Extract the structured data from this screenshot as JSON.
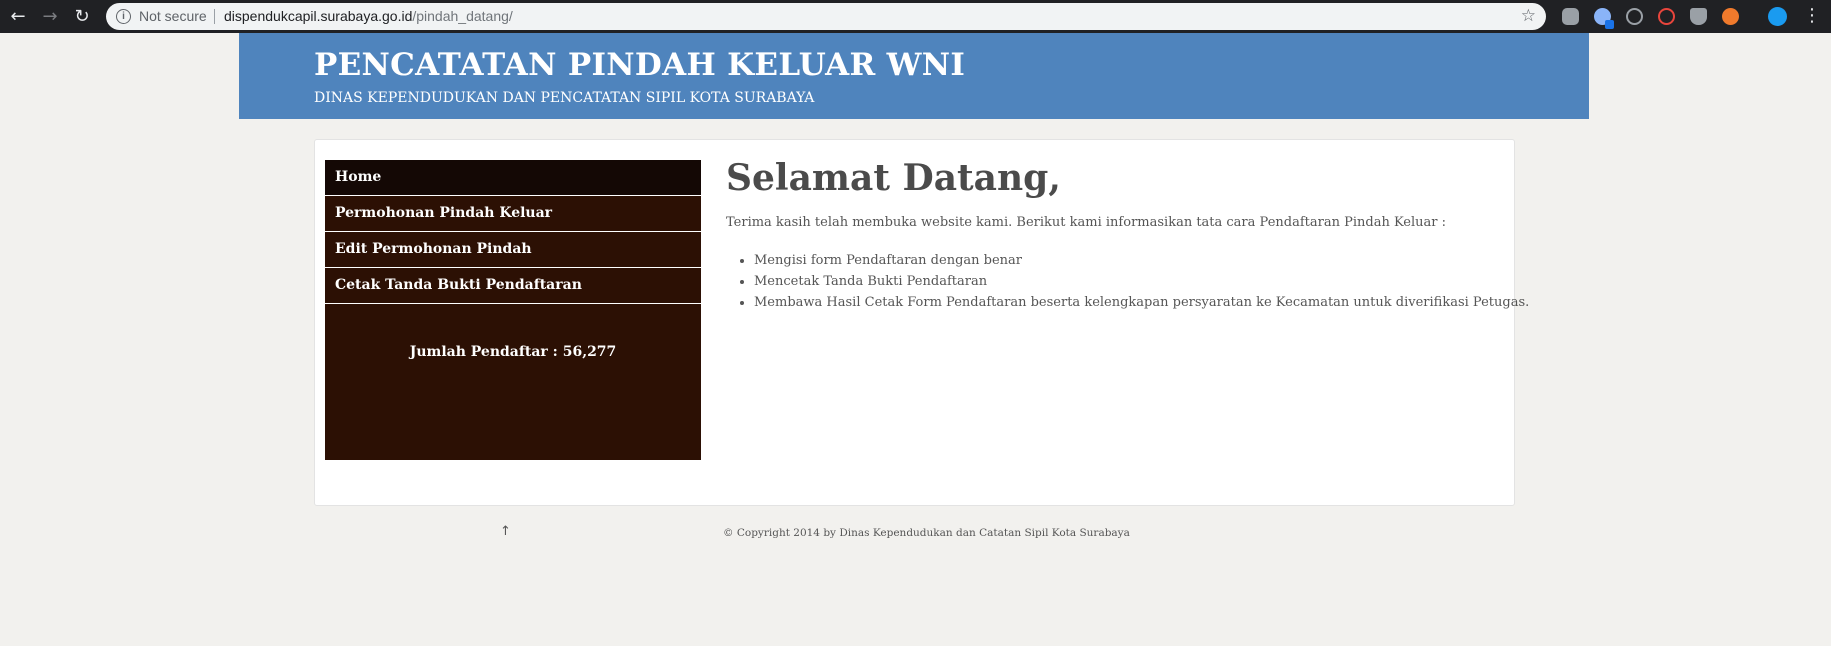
{
  "browser": {
    "security_label": "Not secure",
    "url_host": "dispendukcapil.surabaya.go.id",
    "url_path": "/pindah_datang/",
    "extensions": [
      "mail-extension-icon",
      "chat-extension-icon",
      "minus-circle-icon",
      "adblock-icon",
      "shield-extension-icon",
      "orange-extension-icon",
      "profile-avatar-icon"
    ]
  },
  "header": {
    "title": "PENCATATAN PINDAH KELUAR WNI",
    "subtitle": "DINAS KEPENDUDUKAN DAN PENCATATAN SIPIL KOTA SURABAYA",
    "background_color": "#4f84bd"
  },
  "sidebar": {
    "items": [
      {
        "label": "Home"
      },
      {
        "label": "Permohonan Pindah Keluar"
      },
      {
        "label": "Edit Permohonan Pindah"
      },
      {
        "label": "Cetak Tanda Bukti Pendaftaran"
      }
    ],
    "counter_text": "Jumlah Pendaftar : 56,277",
    "background_color": "#2c1004"
  },
  "main": {
    "heading": "Selamat Datang,",
    "intro": "Terima kasih telah membuka website kami. Berikut kami informasikan tata cara Pendaftaran Pindah Keluar :",
    "steps": [
      "Mengisi form Pendaftaran dengan benar",
      "Mencetak Tanda Bukti Pendaftaran",
      "Membawa Hasil Cetak Form Pendaftaran beserta kelengkapan persyaratan ke Kecamatan untuk diverifikasi Petugas."
    ]
  },
  "footer": {
    "back_to_top": "↑",
    "copyright": "© Copyright 2014 by Dinas Kependudukan dan Catatan Sipil Kota Surabaya"
  }
}
